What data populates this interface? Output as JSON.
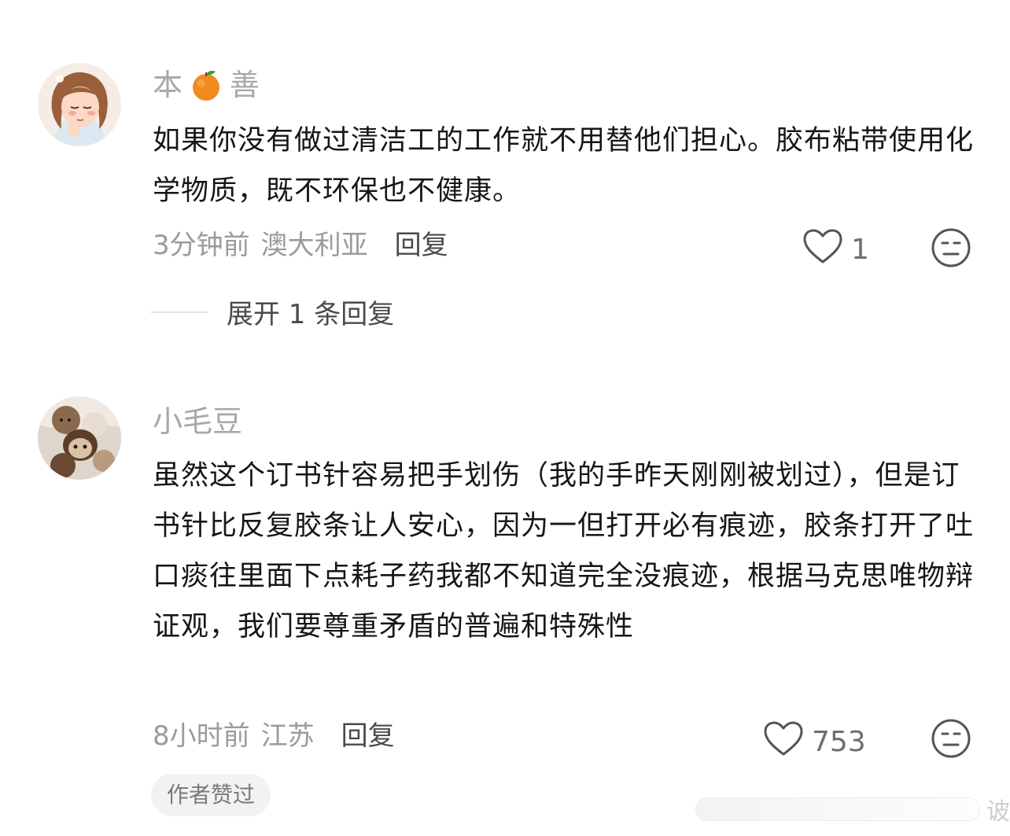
{
  "comments": [
    {
      "username_parts": [
        "本",
        "善"
      ],
      "username_emoji": "orange-emoji",
      "text": "如果你没有做过清洁工的工作就不用替他们担心。胶布粘带使用化学物质，既不环保也不健康。",
      "time": "3分钟前",
      "location": "澳大利亚",
      "reply_label": "回复",
      "like_count": "1",
      "expand_label": "展开 1 条回复"
    },
    {
      "username": "小毛豆",
      "text": "虽然这个订书针容易把手划伤（我的手昨天刚刚被划过），但是订书针比反复胶条让人安心，因为一但打开必有痕迹，胶条打开了吐口痰往里面下点耗子药我都不知道完全没痕迹，根据马克思唯物辩证观，我们要尊重矛盾的普遍和特殊性",
      "time": "8小时前",
      "location": "江苏",
      "reply_label": "回复",
      "like_count": "753",
      "badge": "作者赞过"
    }
  ],
  "watermark": {
    "text": "诐"
  },
  "colors": {
    "username": "#a8a8a8",
    "body_text": "#161616",
    "meta": "#9b9b9b",
    "badge_bg": "#f2f2f2"
  }
}
